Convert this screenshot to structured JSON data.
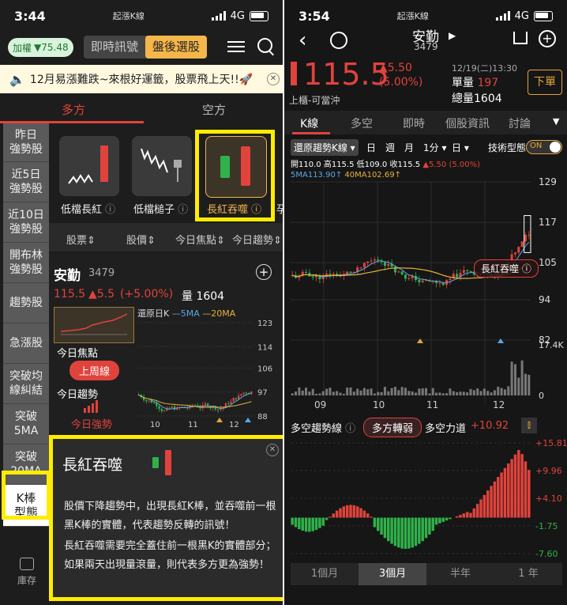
{
  "left": {
    "status": {
      "time": "3:44",
      "carrier": "起漲K線",
      "network": "4G"
    },
    "index_badge": {
      "name": "加權",
      "change": "▼75.48"
    },
    "tabs": {
      "realtime": "即時訊號",
      "afterhours": "盤後選股"
    },
    "banner": "12月易漲難跌~來根好運籤，股票飛上天!!🚀",
    "side_tabs": {
      "long": "多方",
      "short": "空方"
    },
    "sidebar": [
      {
        "label": "昨日\n強勢股"
      },
      {
        "label": "近5日\n強勢股"
      },
      {
        "label": "近10日\n強勢股"
      },
      {
        "label": "開布林\n強勢股"
      },
      {
        "label": "趨勢股"
      },
      {
        "label": "急漲股"
      },
      {
        "label": "突破均\n線糾結"
      },
      {
        "label": "突破\n5MA"
      },
      {
        "label": "突破\n20MA"
      },
      {
        "label": "K棒\n型態"
      }
    ],
    "bottom_nav": {
      "label": "庫存"
    },
    "patterns": [
      {
        "label": "低檔長紅"
      },
      {
        "label": "低檔槌子"
      },
      {
        "label": "長紅吞噬"
      },
      {
        "label": "孕"
      }
    ],
    "columns": {
      "stock": "股票⇕",
      "price": "股價⇕",
      "focus": "今日焦點⇕",
      "trend": "今日趨勢⇕"
    },
    "stock": {
      "name": "安勤",
      "code": "3479",
      "price": "115.5",
      "change": "▲5.5",
      "pct": "(+5.00%)",
      "volume": "量 1604",
      "chart_legend": {
        "base": "還原日K",
        "ma5": "5MA",
        "ma20": "20MA"
      },
      "y_ticks": [
        "123",
        "114",
        "106",
        "97",
        "88"
      ],
      "x_ticks": [
        "10",
        "11",
        "12"
      ],
      "focus_label": "今日焦點",
      "focus_value": "上周線",
      "trend_label": "今日趨勢",
      "trend_value": "今日強勢"
    },
    "popup": {
      "title": "長紅吞噬",
      "line1": "股價下降趨勢中，出現長紅K棒，並吞噬前一根黑K棒的實體，代表趨勢反轉的訊號！",
      "line2": "長紅吞噬需要完全蓋住前一根黑K的實體部分；如果兩天出現量滾量，則代表多方更為強勢！"
    }
  },
  "right": {
    "status": {
      "time": "3:54",
      "carrier": "起漲K線",
      "network": "4G"
    },
    "header": {
      "name": "安勤",
      "code": "3479"
    },
    "quote": {
      "price": "115.5",
      "change": "▲5.50",
      "pct": "(5.00%)",
      "datetime": "12/19(二)13:30",
      "vol_label": "單量",
      "vol": "197",
      "total_label": "總量",
      "total": "1604",
      "market": "上櫃-可當沖",
      "order_btn": "下單"
    },
    "tabs": [
      "K線",
      "多空",
      "即時",
      "個股資訊",
      "討論"
    ],
    "toolbar": {
      "restore": "還原趨勢K線 ▾",
      "day": "日",
      "week": "週",
      "month": "月",
      "min": "1分 ▾",
      "range": "日 ▾",
      "tech": "技術型態",
      "toggle": "ON"
    },
    "ohlc": {
      "open": "開110.0",
      "high": "高115.5",
      "low": "低109.0",
      "close": "收115.5",
      "chg": "▲5.50 (5.00%)",
      "ma5": "5MA113.90↑",
      "ma40": "40MA102.69↑"
    },
    "price_ticks": [
      "129",
      "117",
      "105",
      "94",
      "82"
    ],
    "vol_ticks": [
      "17.4K",
      "0"
    ],
    "x_ticks": [
      "09",
      "10",
      "11",
      "12"
    ],
    "pattern_tag": "長紅吞噬",
    "indicator": {
      "label": "多空趨勢線",
      "signal": "多方轉弱",
      "power_label": "多空力道",
      "power": "+10.92"
    },
    "osc_ticks": [
      "+15.81",
      "+9.96",
      "+4.10",
      "-1.75",
      "-7.60"
    ],
    "periods": [
      "1個月",
      "3個月",
      "半年",
      "1 年"
    ],
    "colors": {
      "up": "#e0433c",
      "down": "#2fb24a",
      "ma5": "#5aa7e6",
      "ma20": "#e6b13c",
      "highlight": "#ffec00"
    }
  }
}
